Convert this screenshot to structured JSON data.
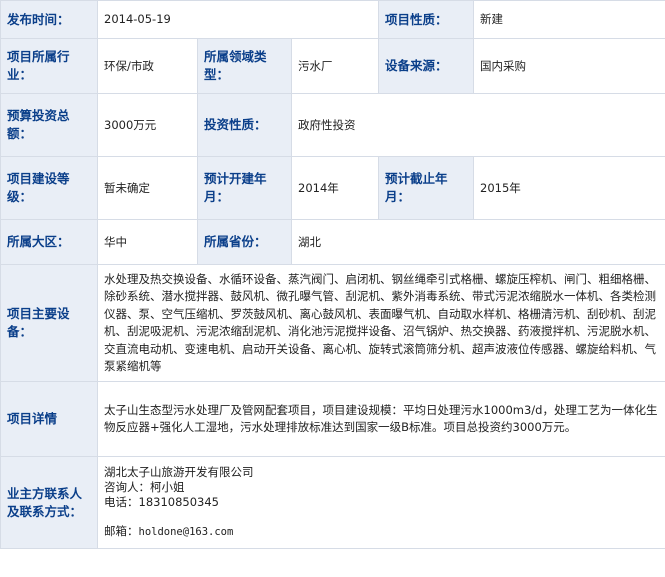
{
  "rows": {
    "publish_time": {
      "label": "发布时间：",
      "value": "2014-05-19"
    },
    "project_nature": {
      "label": "项目性质：",
      "value": "新建"
    },
    "industry": {
      "label": "项目所属行业：",
      "value": "环保/市政"
    },
    "domain_type": {
      "label": "所属领域类型：",
      "value": "污水厂"
    },
    "equipment_source": {
      "label": "设备来源：",
      "value": "国内采购"
    },
    "budget": {
      "label": "预算投资总额：",
      "value": "3000万元"
    },
    "investment_nature": {
      "label": "投资性质：",
      "value": "政府性投资"
    },
    "construction_level": {
      "label": "项目建设等级：",
      "value": "暂未确定"
    },
    "planned_start": {
      "label": "预计开建年月：",
      "value": "2014年"
    },
    "planned_end": {
      "label": "预计截止年月：",
      "value": "2015年"
    },
    "region": {
      "label": "所属大区：",
      "value": "华中"
    },
    "province": {
      "label": "所属省份：",
      "value": "湖北"
    },
    "main_equipment": {
      "label": "项目主要设备：",
      "value": "水处理及热交换设备、水循环设备、蒸汽阀门、启闭机、钢丝绳牵引式格栅、螺旋压榨机、闸门、粗细格栅、除砂系统、潜水搅拌器、鼓风机、微孔曝气管、刮泥机、紫外消毒系统、带式污泥浓缩脱水一体机、各类检测仪器、泵、空气压缩机、罗茨鼓风机、离心鼓风机、表面曝气机、自动取水样机、格栅清污机、刮砂机、刮泥机、刮泥吸泥机、污泥浓缩刮泥机、消化池污泥搅拌设备、沼气锅炉、热交换器、药液搅拌机、污泥脱水机、交直流电动机、变速电机、启动开关设备、离心机、旋转式滚筒筛分机、超声波液位传感器、螺旋给料机、气泵紧缩机等"
    },
    "project_detail": {
      "label": "项目详情",
      "value": "太子山生态型污水处理厂及管网配套项目，项目建设规模：平均日处理污水1000m3/d，处理工艺为一体化生物反应器+强化人工湿地，污水处理排放标准达到国家一级B标准。项目总投资约3000万元。"
    },
    "contact": {
      "label": "业主方联系人及联系方式：",
      "company": "湖北太子山旅游开发有限公司",
      "person": "咨询人：柯小姐",
      "phone": "电话：18310850345",
      "email_label": "邮箱：",
      "email": "holdone@163.com"
    }
  }
}
